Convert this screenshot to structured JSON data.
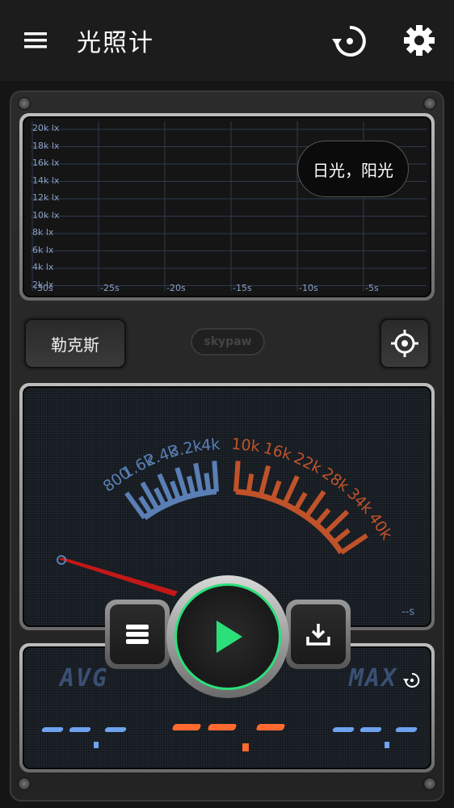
{
  "appbar": {
    "title": "光照计",
    "menu_icon": "menu-icon",
    "history_icon": "history-icon",
    "settings_icon": "gear-icon"
  },
  "chart": {
    "y_labels": [
      "20k lx",
      "18k lx",
      "16k lx",
      "14k lx",
      "12k lx",
      "10k lx",
      "8k lx",
      "6k lx",
      "4k lx",
      "2k lx"
    ],
    "x_labels": [
      "-30s",
      "-25s",
      "-20s",
      "-15s",
      "-10s",
      "-5s"
    ],
    "bubble": "日光，阳光"
  },
  "unit_button": "勒克斯",
  "logo": "skypaw",
  "gauge": {
    "blue_labels": [
      "800",
      "1.6k",
      "2.4k",
      "3.2k",
      "4k"
    ],
    "orange_labels": [
      "10k",
      "16k",
      "22k",
      "28k",
      "34k",
      "40k"
    ],
    "seconds": "--s",
    "colors": {
      "blue": "#5a7fb5",
      "orange": "#c0522a",
      "needle": "#c41818"
    }
  },
  "stats": {
    "avg_label": "AVG",
    "max_label": "MAX",
    "avg_color": "#6fa3f0",
    "cur_color": "#ff6a30",
    "max_color": "#6fa3f0"
  },
  "controls": {
    "list_icon": "list-icon",
    "play_icon": "play-icon",
    "save_icon": "download-icon",
    "play_color": "#2be07a"
  }
}
